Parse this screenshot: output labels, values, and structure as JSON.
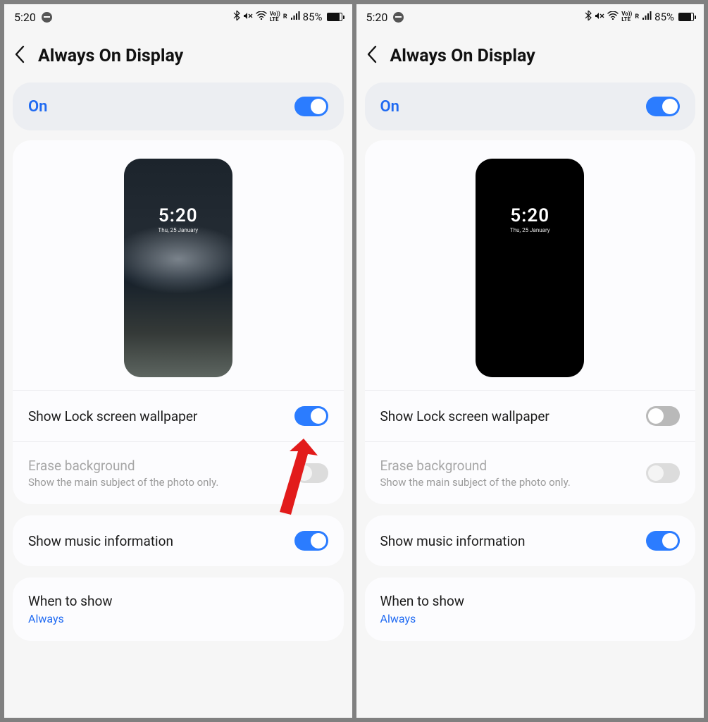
{
  "statusbar": {
    "time": "5:20",
    "battery_text": "85%",
    "battery_fill_pct": 85,
    "status_icons": [
      "bluetooth",
      "mute",
      "wifi",
      "volte",
      "signal-r",
      "signal"
    ]
  },
  "header": {
    "title": "Always On Display"
  },
  "on_block": {
    "label": "On"
  },
  "preview": {
    "time": "5:20",
    "date": "Thu, 25 January"
  },
  "left_panel": {
    "show_wallpaper": {
      "label": "Show Lock screen wallpaper",
      "on": true
    },
    "erase": {
      "label": "Erase background",
      "sub": "Show the main subject of the photo only.",
      "on": false,
      "disabled": true
    },
    "music": {
      "label": "Show music information",
      "on": true
    },
    "when": {
      "label": "When to show",
      "value": "Always"
    }
  },
  "right_panel": {
    "show_wallpaper": {
      "label": "Show Lock screen wallpaper",
      "on": false
    },
    "erase": {
      "label": "Erase background",
      "sub": "Show the main subject of the photo only.",
      "on": false,
      "disabled": true
    },
    "music": {
      "label": "Show music information",
      "on": true
    },
    "when": {
      "label": "When to show",
      "value": "Always"
    }
  }
}
